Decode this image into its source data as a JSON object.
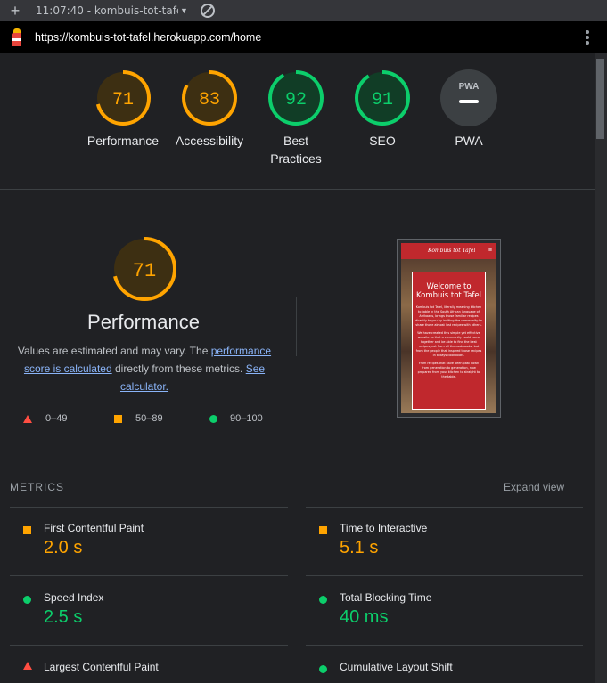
{
  "tab": {
    "time": "11:07:40",
    "title": "kombuis-tot-tafel.he"
  },
  "address": {
    "url": "https://kombuis-tot-tafel.herokuapp.com/home"
  },
  "categories": [
    {
      "label": "Performance",
      "score": "71",
      "value": 71,
      "color": "#ffa400",
      "track": "#3d2f12"
    },
    {
      "label": "Accessibility",
      "score": "83",
      "value": 83,
      "color": "#ffa400",
      "track": "#3d2f12"
    },
    {
      "label": "Best Practices",
      "score": "92",
      "value": 92,
      "color": "#0cce6b",
      "track": "#113d26"
    },
    {
      "label": "SEO",
      "score": "91",
      "value": 91,
      "color": "#0cce6b",
      "track": "#113d26"
    },
    {
      "label": "PWA",
      "score": "PWA",
      "color": "#9aa0a6"
    }
  ],
  "performance": {
    "score": "71",
    "value": 71,
    "title": "Performance",
    "desc_before": "Values are estimated and may vary. The ",
    "desc_link1": "performance score is calculated",
    "desc_middle": " directly from these metrics. ",
    "desc_link2": "See calculator."
  },
  "legend": {
    "fail": "0–49",
    "average": "50–89",
    "pass": "90–100"
  },
  "thumbnail": {
    "brand": "Kombuis tot Tafel",
    "heading": "Welcome to Kombuis tot Tafel",
    "p1": "Kombuis tot Tafel, literally meaning kitchen to table in the South African language of Afrikaans, brings those familiar recipes directly to you by inviting the community to share those almost lost recipes with others.",
    "p2": "We have created this simple yet effective website so that a community could come together and be able to find the best recipes, not from all the cookbooks, but from the people that inspired those recipes in todays cookbooks.",
    "p3": "From recipes that have been past down from generation to generation, now prepared from your kitchen to straight to the table."
  },
  "metrics": {
    "heading": "METRICS",
    "expand_label": "Expand view",
    "items": [
      {
        "name": "First Contentful Paint",
        "value": "2.0 s",
        "status": "average"
      },
      {
        "name": "Time to Interactive",
        "value": "5.1 s",
        "status": "average"
      },
      {
        "name": "Speed Index",
        "value": "2.5 s",
        "status": "pass"
      },
      {
        "name": "Total Blocking Time",
        "value": "40 ms",
        "status": "pass"
      },
      {
        "name": "Largest Contentful Paint",
        "value": "",
        "status": "fail"
      },
      {
        "name": "Cumulative Layout Shift",
        "value": "",
        "status": "pass"
      }
    ]
  }
}
